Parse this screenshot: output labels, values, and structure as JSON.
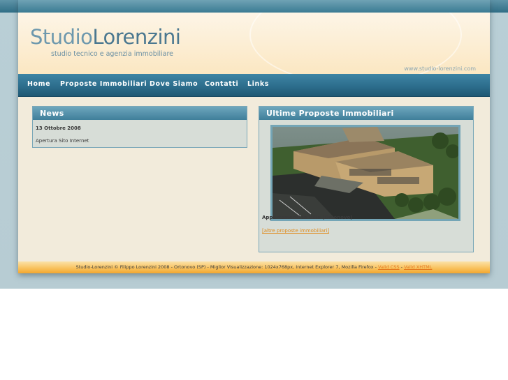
{
  "header": {
    "logo_part1": "Studio",
    "logo_part2": "Lorenzini",
    "tagline": "studio tecnico e agenzia immobiliare",
    "site_url": "www.studio-lorenzini.com"
  },
  "nav": {
    "items": [
      {
        "label": "Home"
      },
      {
        "label": "Proposte Immobiliari"
      },
      {
        "label": "Dove Siamo"
      },
      {
        "label": "Contatti"
      },
      {
        "label": "Links"
      }
    ]
  },
  "news": {
    "title": "News",
    "date": "13 Ottobre 2008",
    "text": "Apertura Sito Internet"
  },
  "proposals": {
    "title": "Ultime Proposte Immobiliari",
    "image_name": "villa-render-photo",
    "caption": "Appartamenti in Villa (Ortonovo)",
    "more_link": "[altre proposte immobiliari]"
  },
  "footer": {
    "text": "Studio-Lorenzini © Filippo Lorenzini 2008 - Ortonovo (SP) - Miglior Visualizzazione: 1024x768px, Internet Explorer 7, Mozilla Firefox -",
    "valid_css": "Valid CSS",
    "separator": "-",
    "valid_xhtml": "Valid XHTML"
  },
  "colors": {
    "nav_bg": "#2d6e8d",
    "header_bg": "#fbe7c2",
    "footer_bg": "#f8c05a",
    "box_title_bg": "#4f8ea8",
    "link": "#e08a1a"
  }
}
